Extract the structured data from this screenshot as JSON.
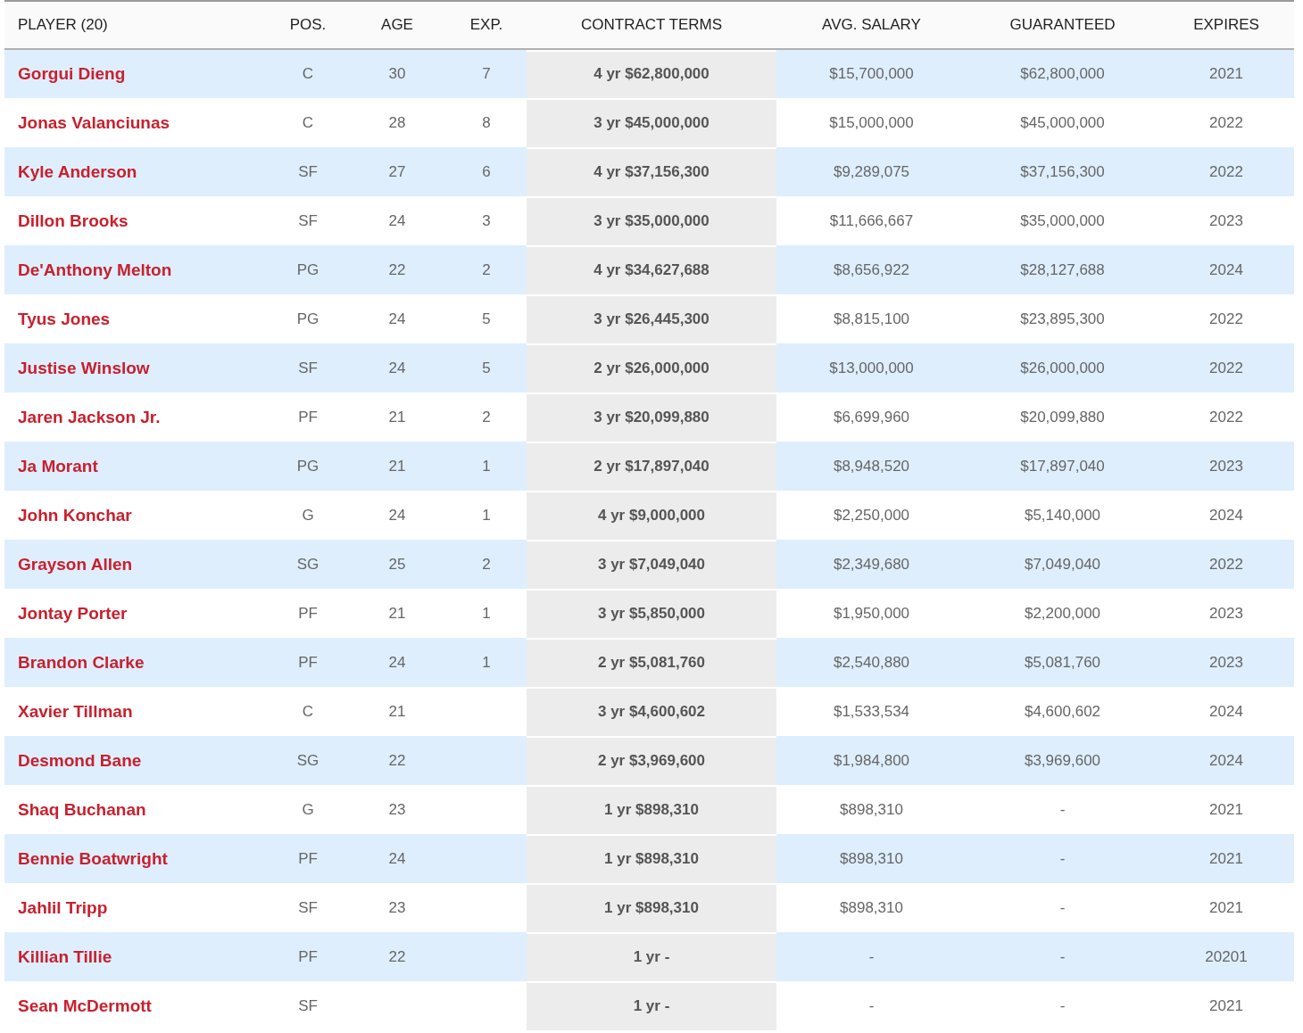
{
  "table": {
    "columns": [
      "PLAYER (20)",
      "POS.",
      "AGE",
      "EXP.",
      "CONTRACT TERMS",
      "AVG. SALARY",
      "GUARANTEED",
      "EXPIRES"
    ],
    "rows": [
      {
        "player": "Gorgui Dieng",
        "pos": "C",
        "age": "30",
        "exp": "7",
        "contract": "4 yr $62,800,000",
        "avg_salary": "$15,700,000",
        "guaranteed": "$62,800,000",
        "expires": "2021"
      },
      {
        "player": "Jonas Valanciunas",
        "pos": "C",
        "age": "28",
        "exp": "8",
        "contract": "3 yr $45,000,000",
        "avg_salary": "$15,000,000",
        "guaranteed": "$45,000,000",
        "expires": "2022"
      },
      {
        "player": "Kyle Anderson",
        "pos": "SF",
        "age": "27",
        "exp": "6",
        "contract": "4 yr $37,156,300",
        "avg_salary": "$9,289,075",
        "guaranteed": "$37,156,300",
        "expires": "2022"
      },
      {
        "player": "Dillon Brooks",
        "pos": "SF",
        "age": "24",
        "exp": "3",
        "contract": "3 yr $35,000,000",
        "avg_salary": "$11,666,667",
        "guaranteed": "$35,000,000",
        "expires": "2023"
      },
      {
        "player": "De'Anthony Melton",
        "pos": "PG",
        "age": "22",
        "exp": "2",
        "contract": "4 yr $34,627,688",
        "avg_salary": "$8,656,922",
        "guaranteed": "$28,127,688",
        "expires": "2024"
      },
      {
        "player": "Tyus Jones",
        "pos": "PG",
        "age": "24",
        "exp": "5",
        "contract": "3 yr $26,445,300",
        "avg_salary": "$8,815,100",
        "guaranteed": "$23,895,300",
        "expires": "2022"
      },
      {
        "player": "Justise Winslow",
        "pos": "SF",
        "age": "24",
        "exp": "5",
        "contract": "2 yr $26,000,000",
        "avg_salary": "$13,000,000",
        "guaranteed": "$26,000,000",
        "expires": "2022"
      },
      {
        "player": "Jaren Jackson Jr.",
        "pos": "PF",
        "age": "21",
        "exp": "2",
        "contract": "3 yr $20,099,880",
        "avg_salary": "$6,699,960",
        "guaranteed": "$20,099,880",
        "expires": "2022"
      },
      {
        "player": "Ja Morant",
        "pos": "PG",
        "age": "21",
        "exp": "1",
        "contract": "2 yr $17,897,040",
        "avg_salary": "$8,948,520",
        "guaranteed": "$17,897,040",
        "expires": "2023"
      },
      {
        "player": "John Konchar",
        "pos": "G",
        "age": "24",
        "exp": "1",
        "contract": "4 yr $9,000,000",
        "avg_salary": "$2,250,000",
        "guaranteed": "$5,140,000",
        "expires": "2024"
      },
      {
        "player": "Grayson Allen",
        "pos": "SG",
        "age": "25",
        "exp": "2",
        "contract": "3 yr $7,049,040",
        "avg_salary": "$2,349,680",
        "guaranteed": "$7,049,040",
        "expires": "2022"
      },
      {
        "player": "Jontay Porter",
        "pos": "PF",
        "age": "21",
        "exp": "1",
        "contract": "3 yr $5,850,000",
        "avg_salary": "$1,950,000",
        "guaranteed": "$2,200,000",
        "expires": "2023"
      },
      {
        "player": "Brandon Clarke",
        "pos": "PF",
        "age": "24",
        "exp": "1",
        "contract": "2 yr $5,081,760",
        "avg_salary": "$2,540,880",
        "guaranteed": "$5,081,760",
        "expires": "2023"
      },
      {
        "player": "Xavier Tillman",
        "pos": "C",
        "age": "21",
        "contract": "3 yr $4,600,602",
        "avg_salary": "$1,533,534",
        "guaranteed": "$4,600,602",
        "expires": "2024"
      },
      {
        "player": "Desmond Bane",
        "pos": "SG",
        "age": "22",
        "contract": "2 yr $3,969,600",
        "avg_salary": "$1,984,800",
        "guaranteed": "$3,969,600",
        "expires": "2024"
      },
      {
        "player": "Shaq Buchanan",
        "pos": "G",
        "age": "23",
        "contract": "1 yr $898,310",
        "avg_salary": "$898,310",
        "guaranteed": "-",
        "expires": "2021"
      },
      {
        "player": "Bennie Boatwright",
        "pos": "PF",
        "age": "24",
        "contract": "1 yr $898,310",
        "avg_salary": "$898,310",
        "guaranteed": "-",
        "expires": "2021"
      },
      {
        "player": "Jahlil Tripp",
        "pos": "SF",
        "age": "23",
        "contract": "1 yr $898,310",
        "avg_salary": "$898,310",
        "guaranteed": "-",
        "expires": "2021"
      },
      {
        "player": "Killian Tillie",
        "pos": "PF",
        "age": "22",
        "contract": "1 yr -",
        "avg_salary": "-",
        "guaranteed": "-",
        "expires": "20201"
      },
      {
        "player": "Sean McDermott",
        "pos": "SF",
        "contract": "1 yr -",
        "avg_salary": "-",
        "guaranteed": "-",
        "expires": "2021"
      }
    ]
  }
}
